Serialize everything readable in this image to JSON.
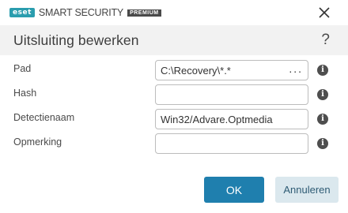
{
  "app": {
    "brand_badge": "eset",
    "product_name": "SMART SECURITY",
    "edition": "PREMIUM"
  },
  "header": {
    "title": "Uitsluiting bewerken",
    "help_label": "?"
  },
  "form": {
    "rows": [
      {
        "label": "Pad",
        "value": "C:\\Recovery\\*.*",
        "has_browse": true,
        "browse_label": "..."
      },
      {
        "label": "Hash",
        "value": ""
      },
      {
        "label": "Detectienaam",
        "value": "Win32/Advare.Optmedia"
      },
      {
        "label": "Opmerking",
        "value": ""
      }
    ],
    "info_glyph": "i"
  },
  "footer": {
    "ok_label": "OK",
    "cancel_label": "Annuleren"
  },
  "colors": {
    "accent": "#1f7fae",
    "brand": "#2a9dae",
    "secondary_button": "#dbe8ee"
  }
}
